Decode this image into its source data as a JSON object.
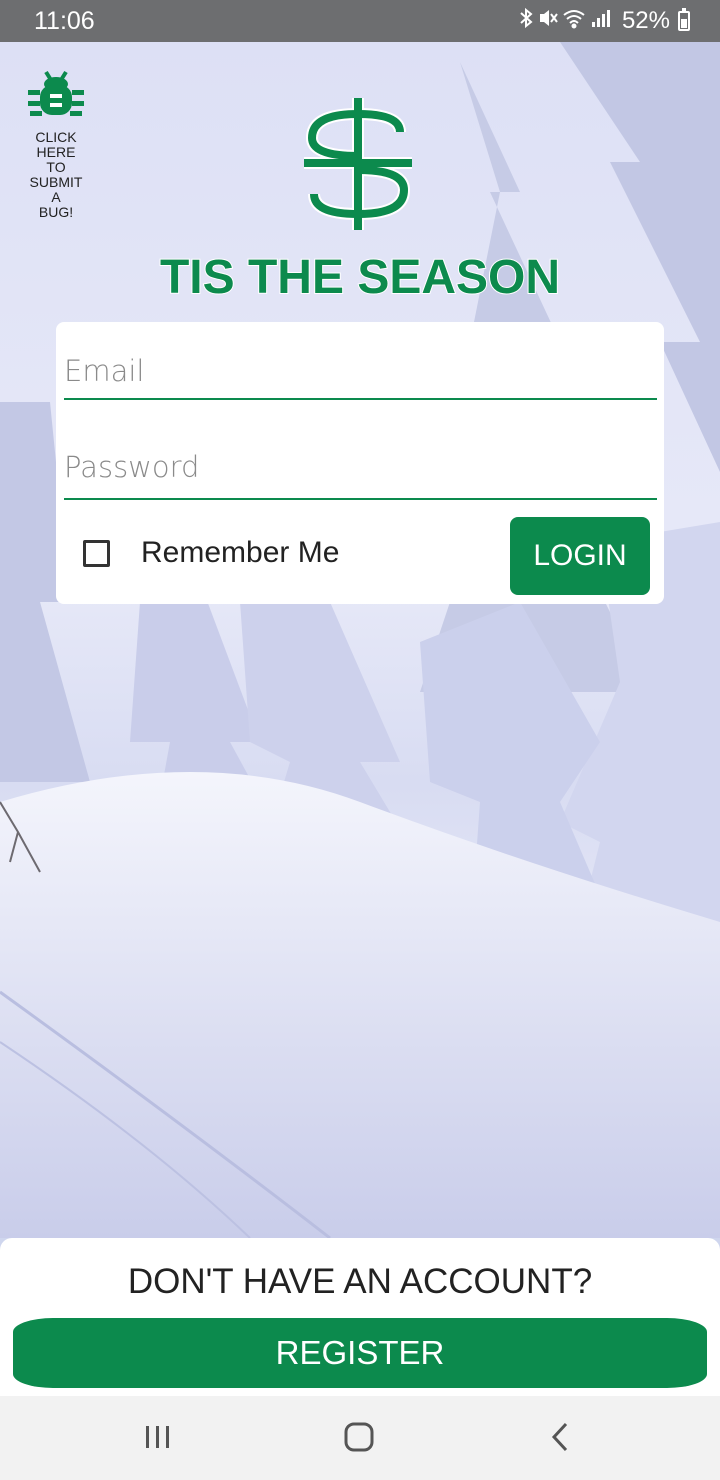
{
  "status_bar": {
    "time": "11:06",
    "icons": [
      "bluetooth-icon",
      "mute-icon",
      "wifi-icon",
      "signal-icon"
    ],
    "battery": "52%"
  },
  "bug_report": {
    "icon": "bug-icon",
    "label": "CLICK HERE TO SUBMIT A BUG!"
  },
  "app": {
    "title": "TIS THE SEASON",
    "brand_color": "#0c8a4d"
  },
  "login": {
    "email_placeholder": "Email",
    "email_value": "",
    "password_placeholder": "Password",
    "password_value": "",
    "remember_label": "Remember Me",
    "remember_checked": false,
    "login_label": "LOGIN"
  },
  "register": {
    "prompt": "DON'T HAVE AN ACCOUNT?",
    "button_label": "REGISTER"
  },
  "nav": {
    "buttons": [
      "recents-icon",
      "home-icon",
      "back-icon"
    ]
  }
}
